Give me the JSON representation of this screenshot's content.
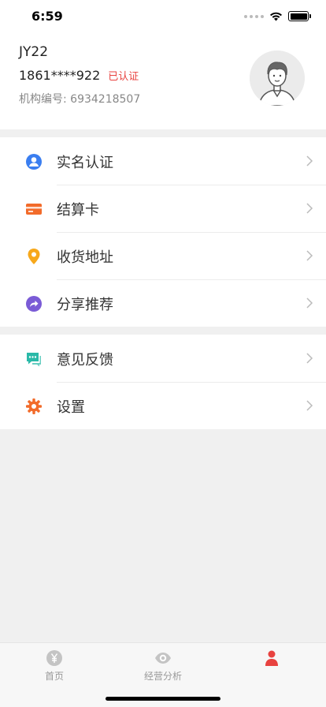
{
  "status_bar": {
    "time": "6:59"
  },
  "profile": {
    "username": "JY22",
    "phone": "1861****922",
    "verified_badge": "已认证",
    "org_label": "机构编号: ",
    "org_number": "6934218507"
  },
  "menu_group_1": [
    {
      "label": "实名认证",
      "icon": "user-circle-icon",
      "color": "#3a7ef0"
    },
    {
      "label": "结算卡",
      "icon": "card-icon",
      "color": "#f26b2a"
    },
    {
      "label": "收货地址",
      "icon": "location-pin-icon",
      "color": "#f7a81b"
    },
    {
      "label": "分享推荐",
      "icon": "share-icon",
      "color": "#7a5bd6"
    }
  ],
  "menu_group_2": [
    {
      "label": "意见反馈",
      "icon": "feedback-icon",
      "color": "#2ab9a8"
    },
    {
      "label": "设置",
      "icon": "gear-icon",
      "color": "#f26b2a"
    }
  ],
  "tabbar": {
    "home_label": "首页",
    "analysis_label": "经营分析"
  },
  "colors": {
    "accent_red": "#e8423f",
    "background": "#f0f0f0"
  }
}
